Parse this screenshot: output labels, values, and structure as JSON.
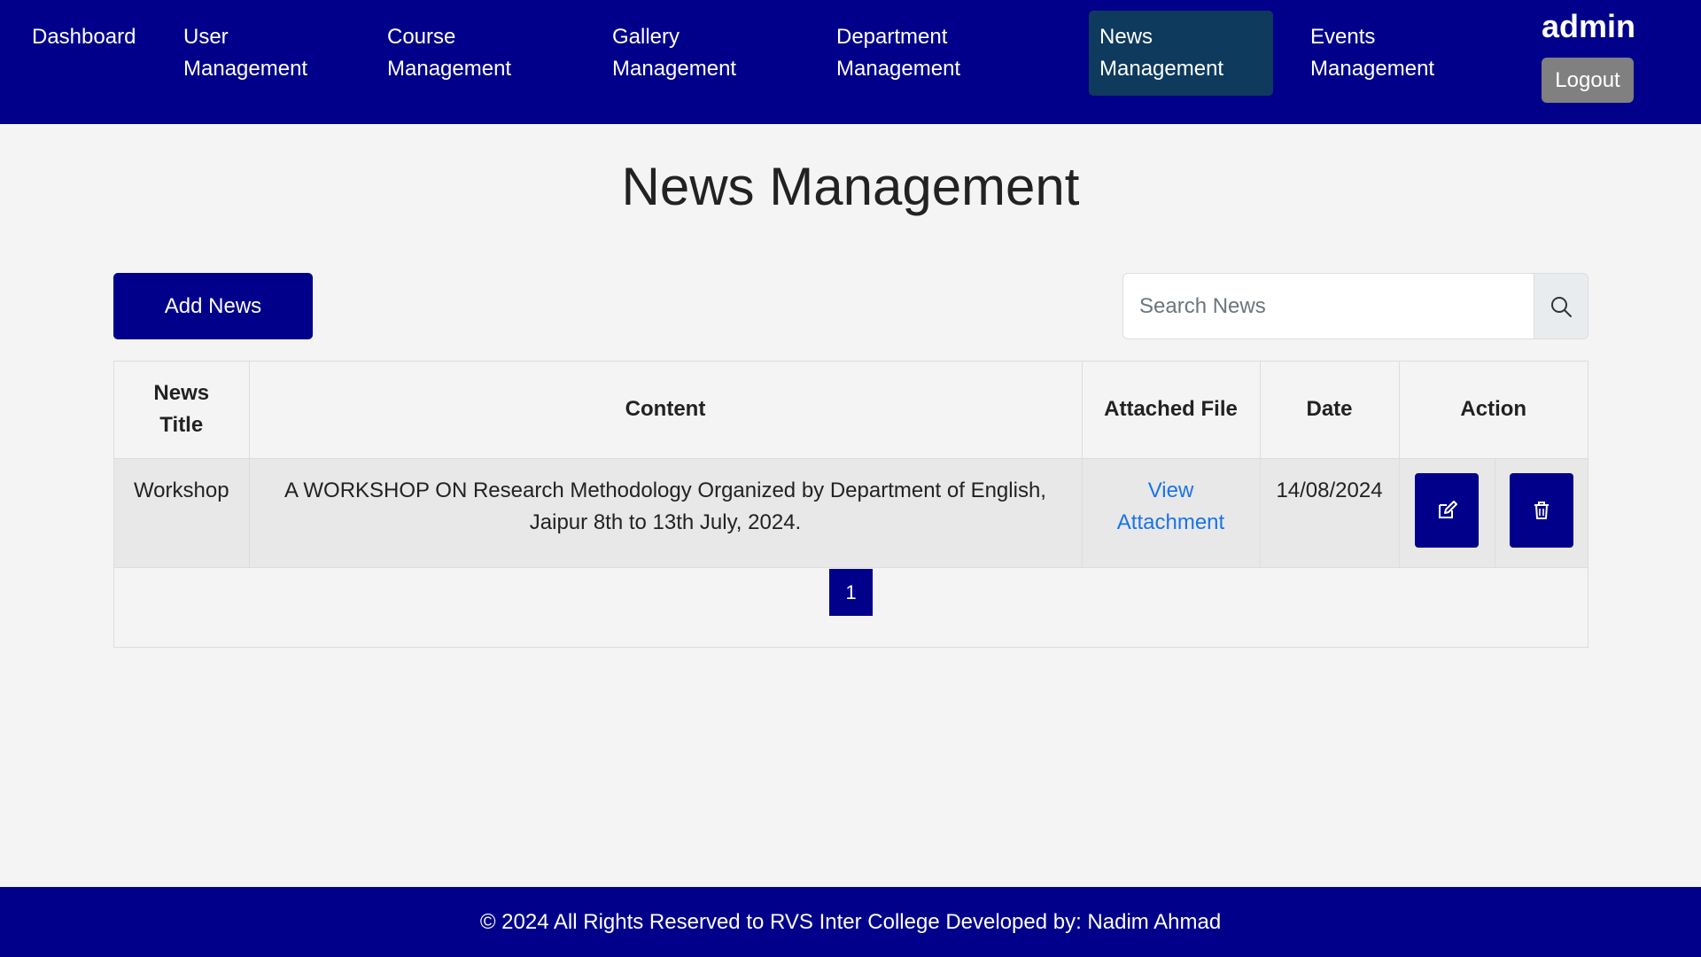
{
  "nav": {
    "items": [
      {
        "line1": "Dashboard",
        "line2": ""
      },
      {
        "line1": "User",
        "line2": "Management"
      },
      {
        "line1": "Course",
        "line2": "Management"
      },
      {
        "line1": "Gallery",
        "line2": "Management"
      },
      {
        "line1": "Department",
        "line2": "Management"
      },
      {
        "line1": "News",
        "line2": "Management"
      },
      {
        "line1": "Events",
        "line2": "Management"
      }
    ],
    "active_item": "News Management",
    "user_name": "admin",
    "logout_label": "Logout"
  },
  "page": {
    "title": "News Management",
    "add_button_label": "Add News",
    "search_placeholder": "Search News"
  },
  "table": {
    "headers": {
      "title_line1": "News",
      "title_line2": "Title",
      "content": "Content",
      "file": "Attached File",
      "date": "Date",
      "action": "Action"
    },
    "rows": [
      {
        "title": "Workshop",
        "content_line1": "A WORKSHOP ON Research Methodology Organized by Department of English,",
        "content_line2": "Jaipur 8th to 13th July, 2024.",
        "file_line1": "View",
        "file_line2": "Attachment",
        "date": "14/08/2024",
        "edit_icon": "edit-icon",
        "delete_icon": "trash-icon"
      }
    ]
  },
  "pagination": {
    "current_page": "1"
  },
  "footer": {
    "text": "© 2024 All Rights Reserved to RVS Inter College Developed by: Nadim Ahmad"
  },
  "colors": {
    "primary": "#00008b",
    "active_nav": "#0e3a5e",
    "link": "#1a73e8",
    "logout": "#808080"
  }
}
